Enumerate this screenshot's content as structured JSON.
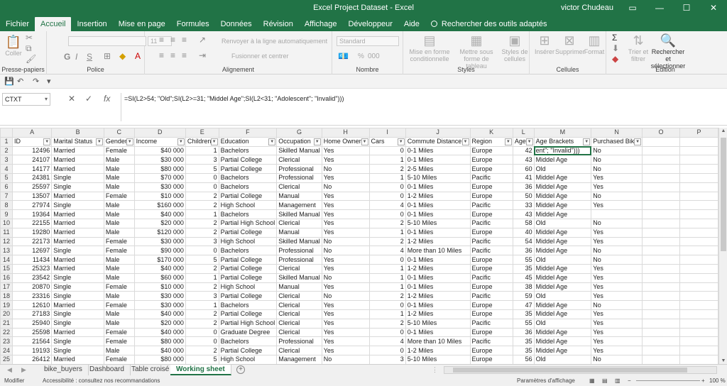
{
  "window": {
    "title": "Excel Project Dataset  -  Excel",
    "user": "victor Chudeau"
  },
  "tabs": [
    "Fichier",
    "Accueil",
    "Insertion",
    "Mise en page",
    "Formules",
    "Données",
    "Révision",
    "Affichage",
    "Développeur",
    "Aide"
  ],
  "tell_me": "Rechercher des outils adaptés",
  "ribbon": {
    "clipboard": {
      "paste": "Coller",
      "label": "Presse-papiers",
      "bold": "G",
      "italic": "I",
      "underline": "S"
    },
    "police": {
      "font_size": "11",
      "label": "Police"
    },
    "alignment": {
      "wrap": "Renvoyer à la ligne automatiquement",
      "merge": "Fusionner et centrer",
      "label": "Alignement"
    },
    "number": {
      "format": "Standard",
      "percent": "%",
      "thousands": "000",
      "label": "Nombre"
    },
    "styles": {
      "cond": "Mise en forme conditionnelle",
      "table": "Mettre sous forme de tableau",
      "cell": "Styles de cellules",
      "label": "Styles"
    },
    "cells": {
      "insert": "Insérer",
      "delete": "Supprimer",
      "format": "Format",
      "label": "Cellules"
    },
    "editing": {
      "sort": "Trier et filtrer",
      "find": "Rechercher et sélectionner",
      "label": "Édition"
    }
  },
  "formula_bar": {
    "name_box": "CTXT",
    "fx": "fx",
    "formula": "=SI(L2>54; \"Old\";SI(L2>=31; \"Middel Age\";SI(L2<31; \"Adolescent\"; \"Invalid\")))"
  },
  "grid": {
    "columns": [
      "A",
      "B",
      "C",
      "D",
      "E",
      "F",
      "G",
      "H",
      "I",
      "J",
      "K",
      "L",
      "M",
      "N",
      "O",
      "P"
    ],
    "headers": [
      "ID",
      "Marital Status",
      "Gender",
      "Income",
      "Children",
      "Education",
      "Occupation",
      "Home Owner",
      "Cars",
      "Commute Distance",
      "Region",
      "Age",
      "Age Brackets",
      "Purchased Bike",
      "",
      ""
    ],
    "rows": [
      [
        "12496",
        "Married",
        "Female",
        "$40 000",
        "1",
        "Bachelors",
        "Skilled Manual",
        "Yes",
        "0",
        "0-1 Miles",
        "Europe",
        "42",
        "ent\"; \"Invalid\")))",
        "No"
      ],
      [
        "24107",
        "Married",
        "Male",
        "$30 000",
        "3",
        "Partial College",
        "Clerical",
        "Yes",
        "1",
        "0-1 Miles",
        "Europe",
        "43",
        "Middel Age",
        "No"
      ],
      [
        "14177",
        "Married",
        "Male",
        "$80 000",
        "5",
        "Partial College",
        "Professional",
        "No",
        "2",
        "2-5 Miles",
        "Europe",
        "60",
        "Old",
        "No"
      ],
      [
        "24381",
        "Single",
        "Male",
        "$70 000",
        "0",
        "Bachelors",
        "Professional",
        "Yes",
        "1",
        "5-10 Miles",
        "Pacific",
        "41",
        "Middel Age",
        "Yes"
      ],
      [
        "25597",
        "Single",
        "Male",
        "$30 000",
        "0",
        "Bachelors",
        "Clerical",
        "No",
        "0",
        "0-1 Miles",
        "Europe",
        "36",
        "Middel Age",
        "Yes"
      ],
      [
        "13507",
        "Married",
        "Female",
        "$10 000",
        "2",
        "Partial College",
        "Manual",
        "Yes",
        "0",
        "1-2 Miles",
        "Europe",
        "50",
        "Middel Age",
        "No"
      ],
      [
        "27974",
        "Single",
        "Male",
        "$160 000",
        "2",
        "High School",
        "Management",
        "Yes",
        "4",
        "0-1 Miles",
        "Pacific",
        "33",
        "Middel Age",
        "Yes"
      ],
      [
        "19364",
        "Married",
        "Male",
        "$40 000",
        "1",
        "Bachelors",
        "Skilled Manual",
        "Yes",
        "0",
        "0-1 Miles",
        "Europe",
        "43",
        "Middel Age",
        ""
      ],
      [
        "22155",
        "Married",
        "Male",
        "$20 000",
        "2",
        "Partial High School",
        "Clerical",
        "Yes",
        "2",
        "5-10 Miles",
        "Pacific",
        "58",
        "Old",
        "No"
      ],
      [
        "19280",
        "Married",
        "Male",
        "$120 000",
        "2",
        "Partial College",
        "Manual",
        "Yes",
        "1",
        "0-1 Miles",
        "Europe",
        "40",
        "Middel Age",
        "Yes"
      ],
      [
        "22173",
        "Married",
        "Female",
        "$30 000",
        "3",
        "High School",
        "Skilled Manual",
        "No",
        "2",
        "1-2 Miles",
        "Pacific",
        "54",
        "Middel Age",
        "Yes"
      ],
      [
        "12697",
        "Single",
        "Female",
        "$90 000",
        "0",
        "Bachelors",
        "Professional",
        "No",
        "4",
        "More than 10 Miles",
        "Pacific",
        "36",
        "Middel Age",
        "No"
      ],
      [
        "11434",
        "Married",
        "Male",
        "$170 000",
        "5",
        "Partial College",
        "Professional",
        "Yes",
        "0",
        "0-1 Miles",
        "Europe",
        "55",
        "Old",
        "No"
      ],
      [
        "25323",
        "Married",
        "Male",
        "$40 000",
        "2",
        "Partial College",
        "Clerical",
        "Yes",
        "1",
        "1-2 Miles",
        "Europe",
        "35",
        "Middel Age",
        "Yes"
      ],
      [
        "23542",
        "Single",
        "Male",
        "$60 000",
        "1",
        "Partial College",
        "Skilled Manual",
        "No",
        "1",
        "0-1 Miles",
        "Pacific",
        "45",
        "Middel Age",
        "Yes"
      ],
      [
        "20870",
        "Single",
        "Female",
        "$10 000",
        "2",
        "High School",
        "Manual",
        "Yes",
        "1",
        "0-1 Miles",
        "Europe",
        "38",
        "Middel Age",
        "Yes"
      ],
      [
        "23316",
        "Single",
        "Male",
        "$30 000",
        "3",
        "Partial College",
        "Clerical",
        "No",
        "2",
        "1-2 Miles",
        "Pacific",
        "59",
        "Old",
        "Yes"
      ],
      [
        "12610",
        "Married",
        "Female",
        "$30 000",
        "1",
        "Bachelors",
        "Clerical",
        "Yes",
        "0",
        "0-1 Miles",
        "Europe",
        "47",
        "Middel Age",
        "No"
      ],
      [
        "27183",
        "Single",
        "Male",
        "$40 000",
        "2",
        "Partial College",
        "Clerical",
        "Yes",
        "1",
        "1-2 Miles",
        "Europe",
        "35",
        "Middel Age",
        "Yes"
      ],
      [
        "25940",
        "Single",
        "Male",
        "$20 000",
        "2",
        "Partial High School",
        "Clerical",
        "Yes",
        "2",
        "5-10 Miles",
        "Pacific",
        "55",
        "Old",
        "Yes"
      ],
      [
        "25598",
        "Married",
        "Female",
        "$40 000",
        "0",
        "Graduate Degree",
        "Clerical",
        "Yes",
        "0",
        "0-1 Miles",
        "Europe",
        "36",
        "Middel Age",
        "Yes"
      ],
      [
        "21564",
        "Single",
        "Female",
        "$80 000",
        "0",
        "Bachelors",
        "Professional",
        "Yes",
        "4",
        "More than 10 Miles",
        "Pacific",
        "35",
        "Middel Age",
        "Yes"
      ],
      [
        "19193",
        "Single",
        "Male",
        "$40 000",
        "2",
        "Partial College",
        "Clerical",
        "Yes",
        "0",
        "1-2 Miles",
        "Europe",
        "35",
        "Middel Age",
        "Yes"
      ],
      [
        "26412",
        "Married",
        "Female",
        "$80 000",
        "5",
        "High School",
        "Management",
        "No",
        "3",
        "5-10 Miles",
        "Europe",
        "56",
        "Old",
        "No"
      ]
    ]
  },
  "sheets": {
    "tabs": [
      "bike_buyers",
      "Dashboard",
      "Table croisé",
      "Working sheet"
    ],
    "active": "Working sheet"
  },
  "status": {
    "mode": "Modifier",
    "accessibility": "Accessibilité : consultez nos recommandations",
    "display_settings": "Paramètres d'affichage",
    "zoom": "100 %"
  },
  "colors": {
    "accent": "#217346"
  }
}
